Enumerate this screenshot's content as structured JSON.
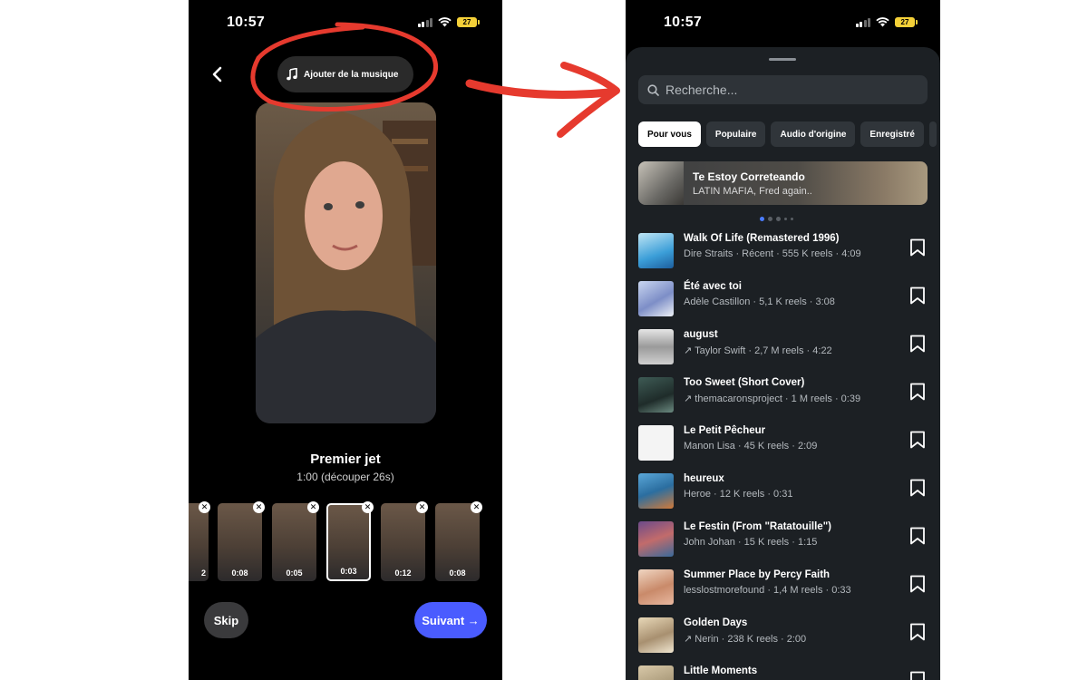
{
  "status": {
    "time": "10:57",
    "battery": "27"
  },
  "left": {
    "music_button": "Ajouter de la musique",
    "draft_title": "Premier jet",
    "draft_sub": "1:00 (découper 26s)",
    "clips": [
      "2",
      "0:08",
      "0:05",
      "0:03",
      "0:12",
      "0:08"
    ],
    "skip_label": "Skip",
    "next_label": "Suivant →"
  },
  "right": {
    "search_placeholder": "Recherche...",
    "chips": [
      "Pour vous",
      "Populaire",
      "Audio d'origine",
      "Enregistré"
    ],
    "featured": {
      "title": "Te Estoy Correteando",
      "artist": "LATIN MAFIA, Fred again.."
    },
    "tracks": [
      {
        "title": "Walk Of Life (Remastered 1996)",
        "meta": "Dire Straits · Récent · 555 K reels · 4:09"
      },
      {
        "title": "Été avec toi",
        "meta": "Adèle Castillon · 5,1 K reels · 3:08"
      },
      {
        "title": "august",
        "meta": "↗ Taylor Swift · 2,7 M reels · 4:22"
      },
      {
        "title": "Too Sweet (Short Cover)",
        "meta": "↗ themacaronsproject · 1 M reels · 0:39"
      },
      {
        "title": "Le Petit Pêcheur",
        "meta": "Manon Lisa · 45 K reels · 2:09"
      },
      {
        "title": "heureux",
        "meta": "Heroe · 12 K reels · 0:31"
      },
      {
        "title": "Le Festin (From \"Ratatouille\")",
        "meta": "John Johan · 15 K reels · 1:15"
      },
      {
        "title": "Summer Place by Percy Faith",
        "meta": "lesslostmorefound · 1,4 M reels · 0:33"
      },
      {
        "title": "Golden Days",
        "meta": "↗ Nerin · 238 K reels · 2:00"
      },
      {
        "title": "Little Moments",
        "meta": ""
      }
    ]
  },
  "colors": {
    "accent": "#4a5cff",
    "annotation_red": "#e63a2e",
    "sheet_bg": "#1c2024"
  }
}
